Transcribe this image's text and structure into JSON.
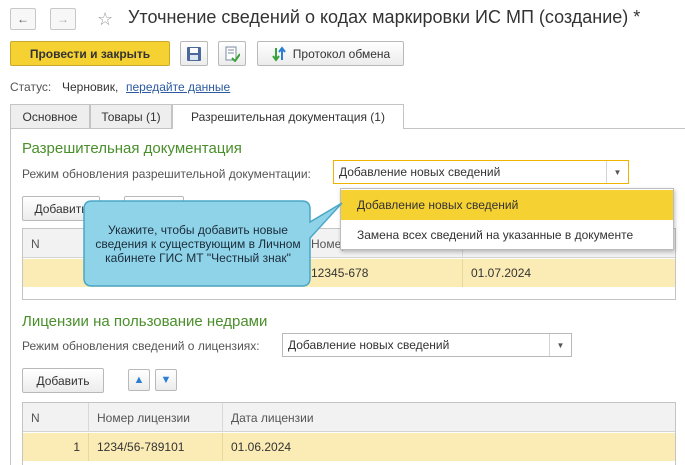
{
  "header": {
    "title": "Уточнение сведений о кодах маркировки ИС МП (создание) *",
    "back_icon": "arrow-left-icon",
    "forward_icon": "arrow-right-icon",
    "favorite_icon": "star-icon"
  },
  "toolbar": {
    "post_and_close": "Провести и закрыть",
    "save_icon": "floppy-disk-icon",
    "post_icon": "post-document-icon",
    "exchange_log": "Протокол обмена"
  },
  "status": {
    "label": "Статус:",
    "value": "Черновик,",
    "link": "передайте данные"
  },
  "tabs": [
    {
      "label": "Основное"
    },
    {
      "label": "Товары (1)"
    },
    {
      "label": "Разрешительная документация",
      "active": true
    },
    {
      "label": "(1)"
    }
  ],
  "permits": {
    "section_title": "Разрешительная документация",
    "mode_label": "Режим обновления разрешительной документации:",
    "mode_value": "Добавление новых сведений",
    "add_button": "Добавить",
    "table": {
      "headers": [
        "N",
        "Номер",
        ""
      ],
      "rows": [
        {
          "n": "",
          "number": "12345-678",
          "date": "01.07.2024"
        }
      ]
    },
    "dropdown_options": [
      "Добавление новых сведений",
      "Замена всех сведений на указанные в документе"
    ]
  },
  "licenses": {
    "section_title": "Лицензии на пользование недрами",
    "mode_label": "Режим обновления сведений о лицензиях:",
    "mode_value": "Добавление новых сведений",
    "add_button": "Добавить",
    "table": {
      "headers": [
        "N",
        "Номер лицензии",
        "Дата лицензии"
      ],
      "rows": [
        {
          "n": "1",
          "number": "1234/56-789101",
          "date": "01.06.2024"
        }
      ]
    }
  },
  "callout": {
    "text": "Укажите, чтобы добавить новые сведения к существующим в Личном кабинете ГИС МТ \"Честный знак\""
  },
  "colors": {
    "primary_button": "#f6d132",
    "section_title": "#4a8f2b",
    "selected_row": "#fbecb5",
    "callout_fill": "#8fd3e8",
    "link": "#2b5aa0"
  }
}
